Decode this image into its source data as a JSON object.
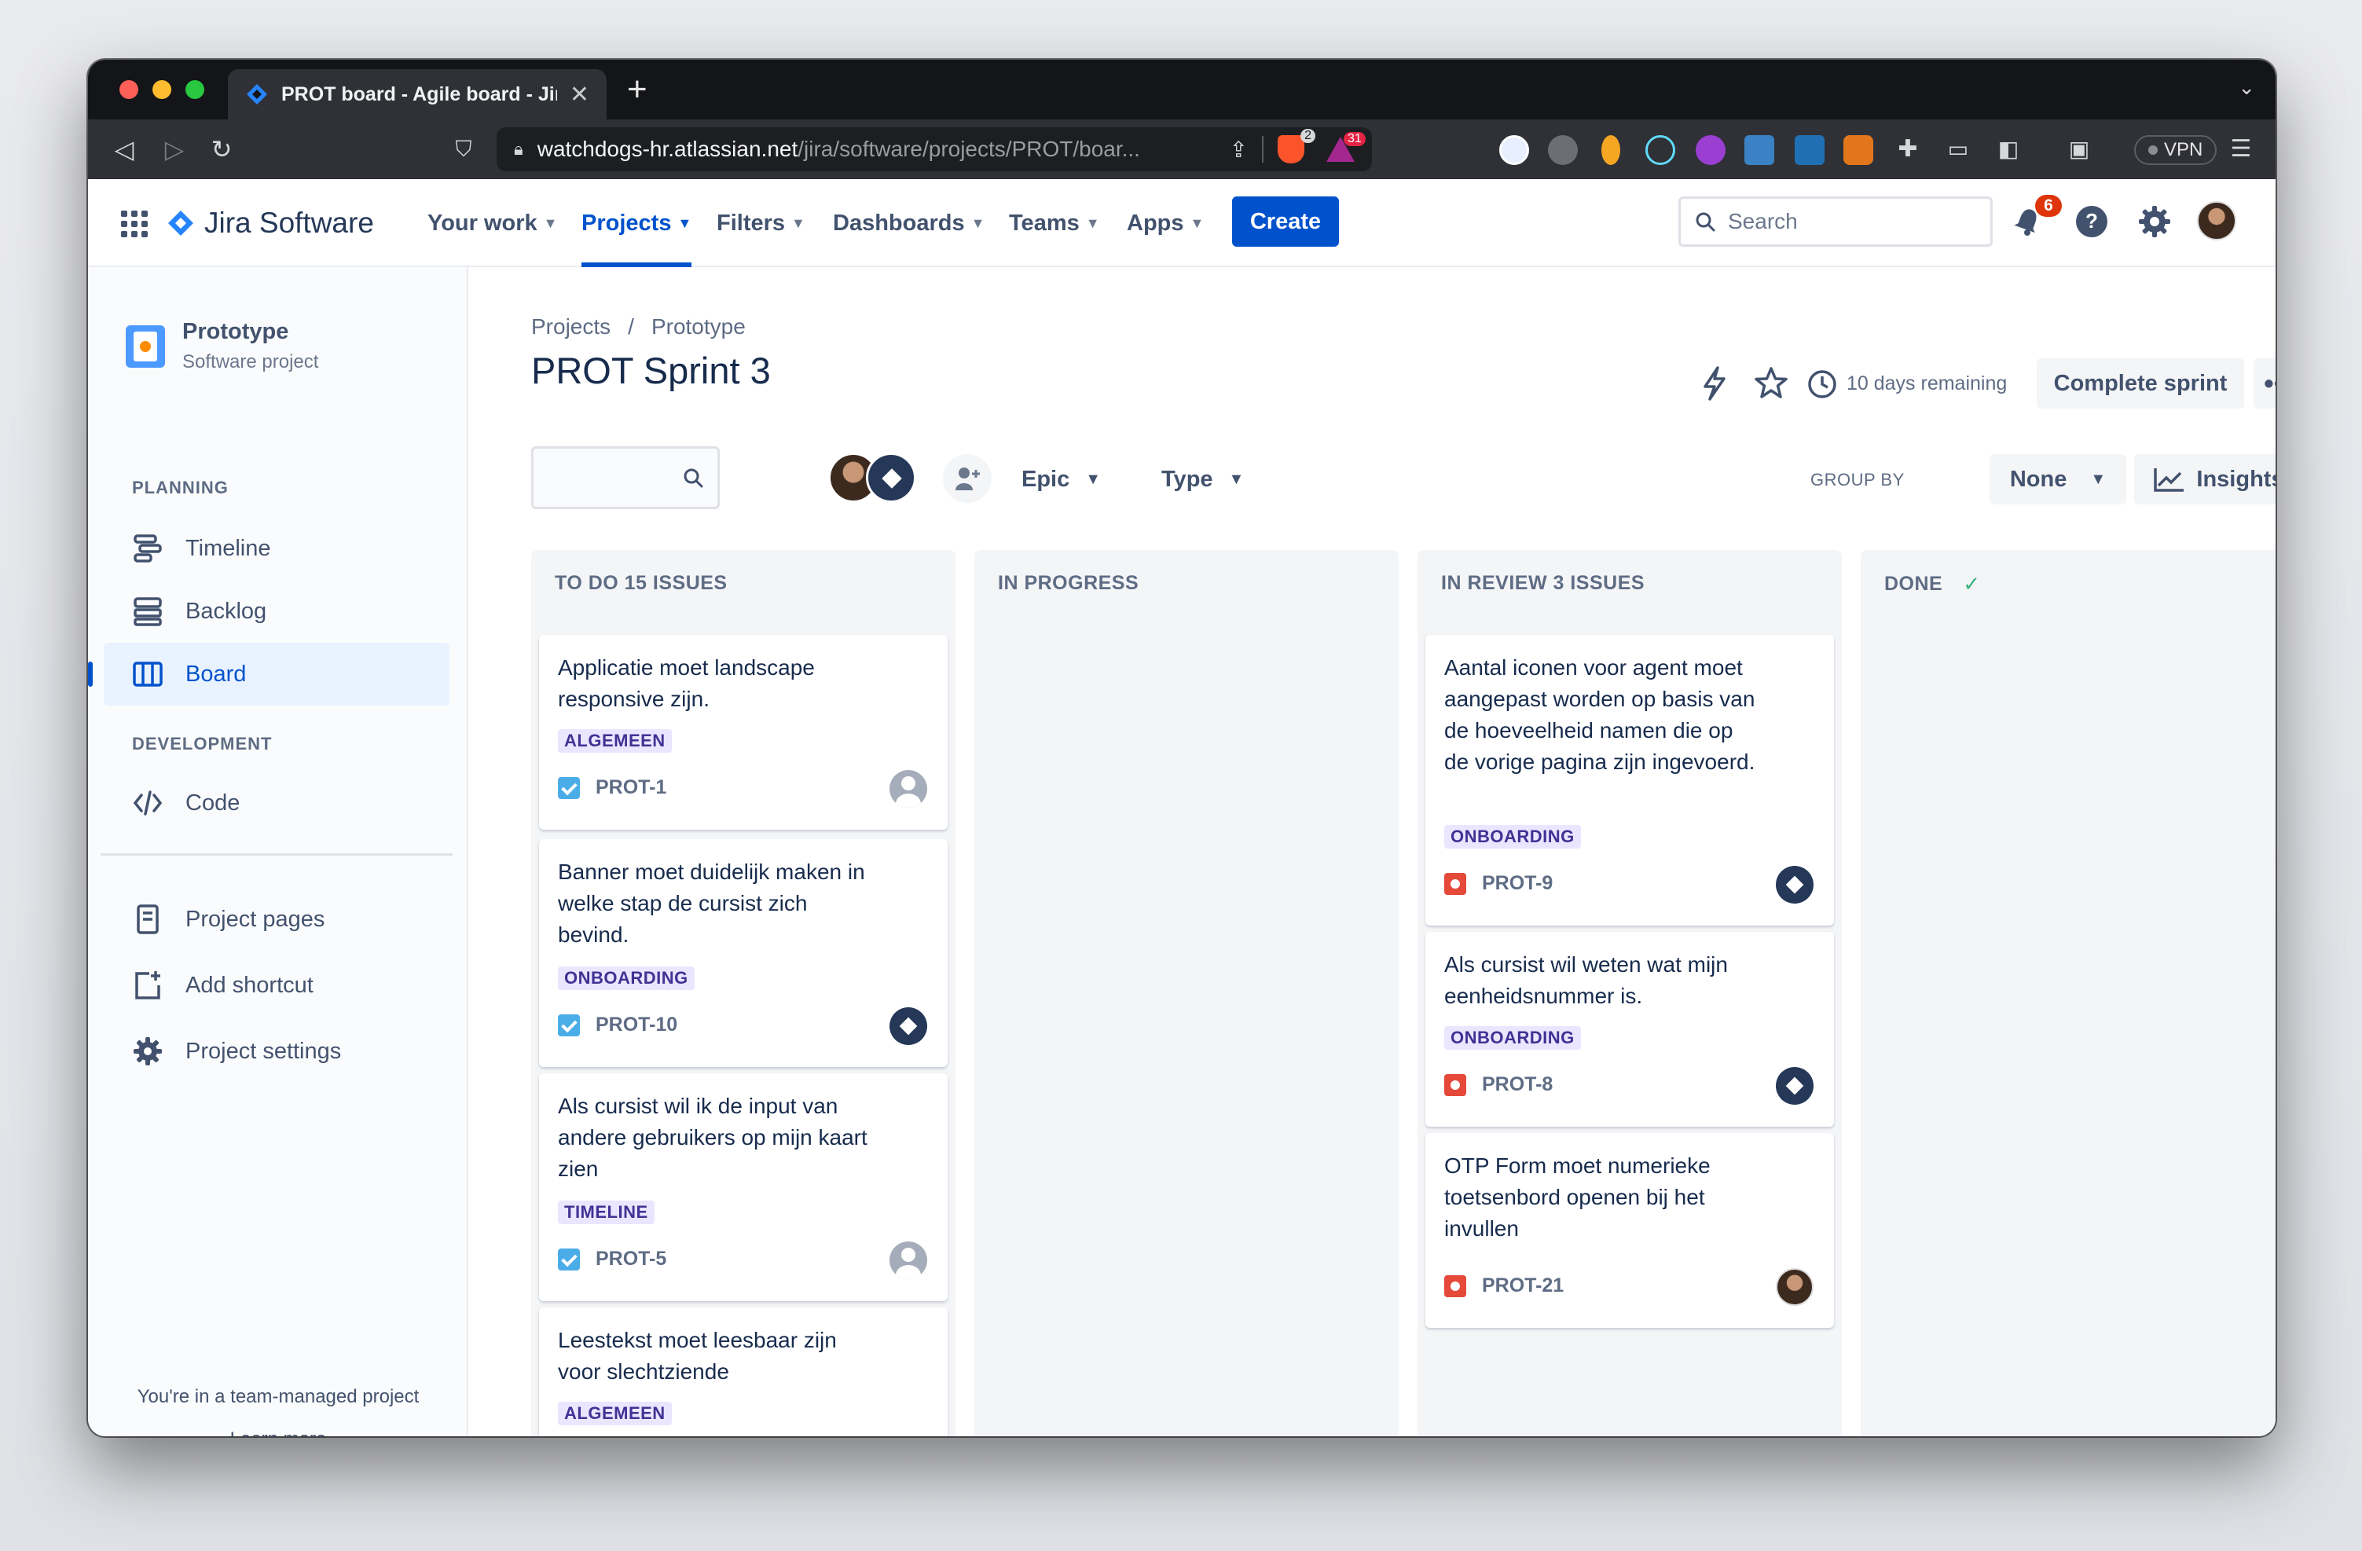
{
  "browser": {
    "tab_title": "PROT board - Agile board - Jira",
    "url_host": "watchdogs-hr.atlassian.net",
    "url_path": "/jira/software/projects/PROT/boar...",
    "brave_badge": "2",
    "alert_badge": "31",
    "vpn_label": "VPN"
  },
  "nav": {
    "product": "Jira Software",
    "items": [
      {
        "label": "Your work"
      },
      {
        "label": "Projects"
      },
      {
        "label": "Filters"
      },
      {
        "label": "Dashboards"
      },
      {
        "label": "Teams"
      },
      {
        "label": "Apps"
      }
    ],
    "create_label": "Create",
    "search_placeholder": "Search",
    "notifications_count": "6"
  },
  "sidebar": {
    "project_name": "Prototype",
    "project_type": "Software project",
    "planning_heading": "PLANNING",
    "planning_items": [
      {
        "label": "Timeline"
      },
      {
        "label": "Backlog"
      },
      {
        "label": "Board"
      }
    ],
    "development_heading": "DEVELOPMENT",
    "development_items": [
      {
        "label": "Code"
      }
    ],
    "extra_items": [
      {
        "label": "Project pages"
      },
      {
        "label": "Add shortcut"
      },
      {
        "label": "Project settings"
      }
    ],
    "team_managed_note": "You're in a team-managed project",
    "learn_more": "Learn more"
  },
  "board": {
    "breadcrumb_projects": "Projects",
    "breadcrumb_sep": "/",
    "breadcrumb_project": "Prototype",
    "title": "PROT Sprint 3",
    "days_remaining": "10 days remaining",
    "complete_sprint": "Complete sprint",
    "epic_filter": "Epic",
    "type_filter": "Type",
    "group_by_label": "GROUP BY",
    "group_by_value": "None",
    "insights": "Insights",
    "columns": [
      {
        "title": "TO DO 15 ISSUES",
        "cards": [
          {
            "title": "Applicatie moet landscape responsive zijn.",
            "epic": "ALGEMEEN",
            "key": "PROT-1"
          },
          {
            "title": "Banner moet duidelijk maken in welke stap de cursist zich bevind.",
            "epic": "ONBOARDING",
            "key": "PROT-10"
          },
          {
            "title": "Als cursist wil ik de input van andere gebruikers op mijn kaart zien",
            "epic": "TIMELINE",
            "key": "PROT-5"
          },
          {
            "title": "Leestekst moet leesbaar zijn voor slechtziende",
            "epic": "ALGEMEEN",
            "key": ""
          }
        ]
      },
      {
        "title": "IN PROGRESS",
        "cards": []
      },
      {
        "title": "IN REVIEW 3 ISSUES",
        "cards": [
          {
            "title": "Aantal iconen voor agent moet aangepast worden op basis van de hoeveelheid namen die op de vorige pagina zijn ingevoerd.",
            "epic": "ONBOARDING",
            "key": "PROT-9"
          },
          {
            "title": "Als cursist wil weten wat mijn eenheidsnummer is.",
            "epic": "ONBOARDING",
            "key": "PROT-8"
          },
          {
            "title": "OTP Form moet numerieke toetsenbord openen bij het invullen",
            "epic": "",
            "key": "PROT-21"
          }
        ]
      },
      {
        "title": "DONE",
        "cards": []
      }
    ]
  },
  "colors": {
    "brand_blue": "#0052cc",
    "epic_bg": "#eae6ff",
    "epic_text": "#403294",
    "story_blue": "#4bade8",
    "bug_red": "#e5493a",
    "done_green": "#36b37e"
  }
}
